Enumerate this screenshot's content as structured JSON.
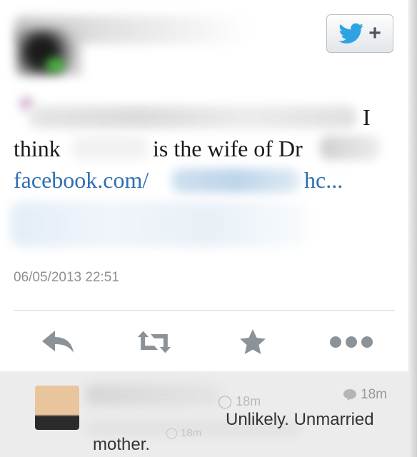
{
  "tweet": {
    "line_i": "I",
    "line_think": "think",
    "line_wife": "is the wife of Dr",
    "link_start": "facebook.com/",
    "link_end": "hc...",
    "timestamp": "06/05/2013 22:51"
  },
  "header": {
    "follow_button_plus": "+"
  },
  "actions": {
    "icons": [
      "reply-icon",
      "retweet-icon",
      "favorite-icon",
      "more-icon"
    ]
  },
  "reply": {
    "faded_time": "18m",
    "time": "18m",
    "text_line1": "Unlikely. Unmarried",
    "text_line2": "mother.",
    "ghost_time": "18m"
  },
  "colors": {
    "link": "#2f6fb0",
    "twitter_blue": "#2ea3e3",
    "icon_gray": "#8b9298",
    "reply_bg": "#ececec"
  }
}
